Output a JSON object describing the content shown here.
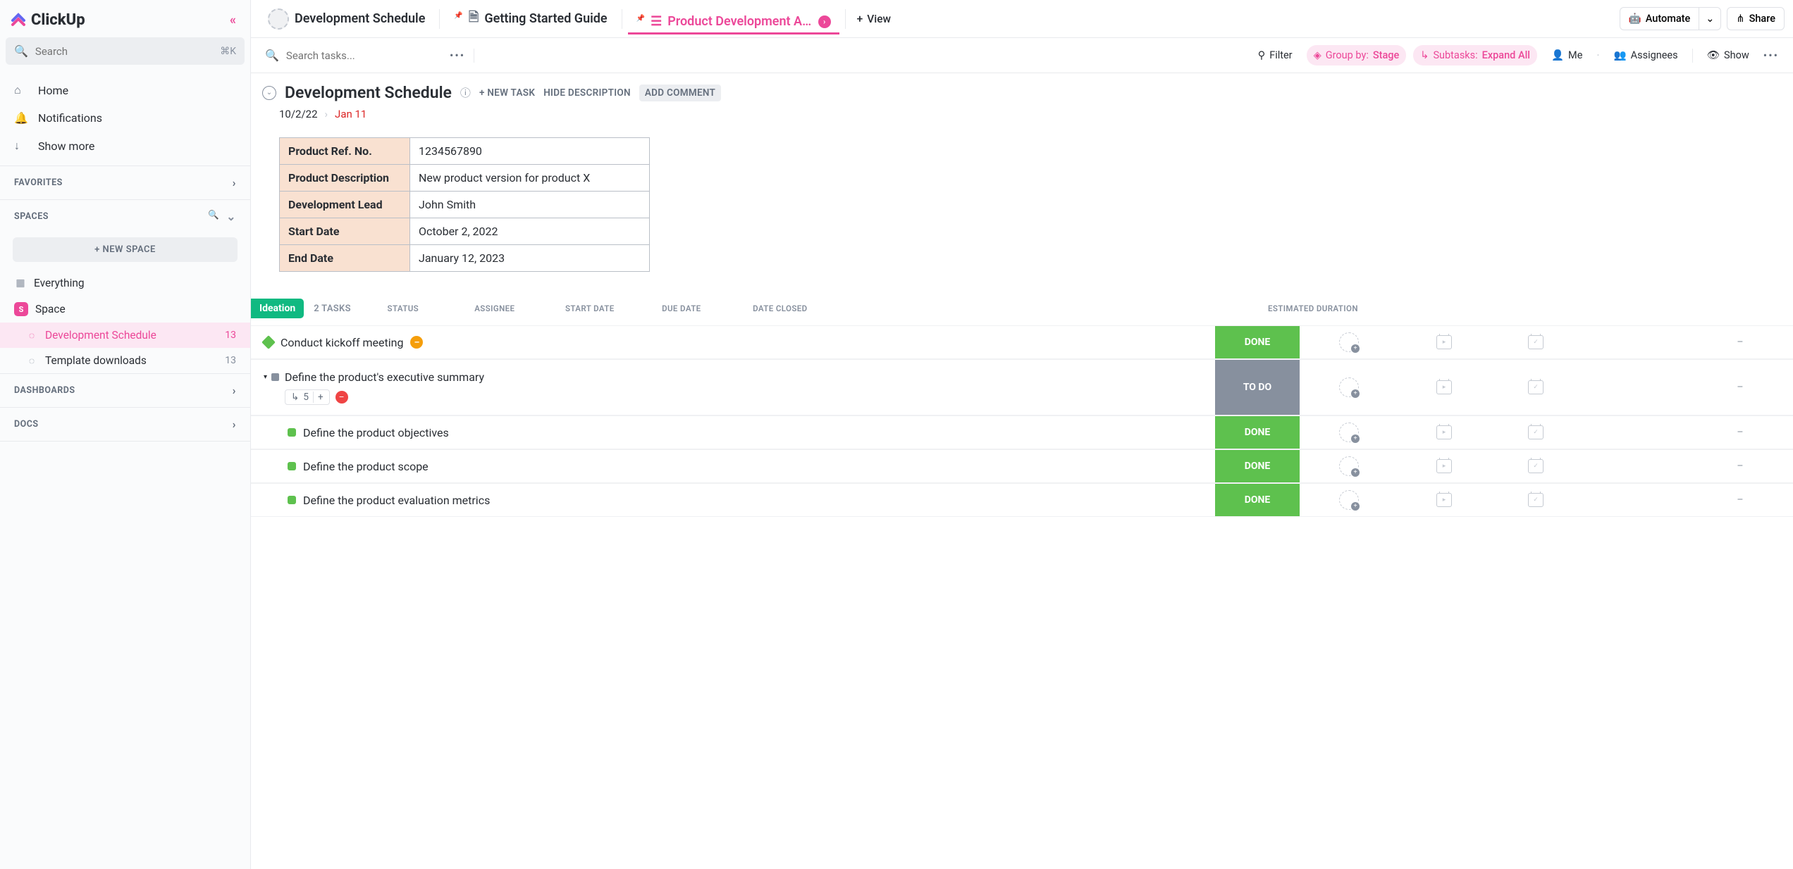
{
  "sidebar": {
    "brand": "ClickUp",
    "search_placeholder": "Search",
    "search_shortcut": "⌘K",
    "nav": [
      {
        "label": "Home"
      },
      {
        "label": "Notifications"
      },
      {
        "label": "Show more"
      }
    ],
    "favorites_title": "FAVORITES",
    "spaces_title": "SPACES",
    "new_space": "NEW SPACE",
    "everything": "Everything",
    "space_letter": "S",
    "space_name": "Space",
    "lists": [
      {
        "label": "Development Schedule",
        "count": "13",
        "active": true
      },
      {
        "label": "Template downloads",
        "count": "13",
        "active": false
      }
    ],
    "dashboards": "DASHBOARDS",
    "docs": "DOCS"
  },
  "tabs": {
    "items": [
      {
        "label": "Development Schedule"
      },
      {
        "label": "Getting Started Guide"
      },
      {
        "label": "Product Development Activities"
      }
    ],
    "add_view": "View",
    "automate": "Automate",
    "share": "Share"
  },
  "toolbar": {
    "search_placeholder": "Search tasks...",
    "filter": "Filter",
    "group_by_label": "Group by:",
    "group_by_value": "Stage",
    "subtasks_label": "Subtasks:",
    "subtasks_value": "Expand All",
    "me": "Me",
    "assignees": "Assignees",
    "show": "Show"
  },
  "page": {
    "title": "Development Schedule",
    "new_task": "+ NEW TASK",
    "hide_desc": "HIDE DESCRIPTION",
    "add_comment": "ADD COMMENT",
    "created": "10/2/22",
    "due": "Jan 11",
    "info": [
      {
        "k": "Product Ref. No.",
        "v": "1234567890"
      },
      {
        "k": "Product Description",
        "v": "New product version for product X"
      },
      {
        "k": "Development Lead",
        "v": "John Smith"
      },
      {
        "k": "Start Date",
        "v": "October 2, 2022"
      },
      {
        "k": "End Date",
        "v": "January 12, 2023"
      }
    ]
  },
  "group": {
    "name": "Ideation",
    "count": "2 TASKS",
    "cols": {
      "status": "STATUS",
      "assignee": "ASSIGNEE",
      "start": "START DATE",
      "due": "DUE DATE",
      "closed": "DATE CLOSED",
      "est": "ESTIMATED DURATION"
    }
  },
  "tasks": [
    {
      "name": "Conduct kickoff meeting",
      "status": "DONE",
      "status_class": "done",
      "kind": "top",
      "priority": "urgent"
    },
    {
      "name": "Define the product's executive summary",
      "status": "TO DO",
      "status_class": "todo",
      "kind": "top-todo",
      "sub_count": "5",
      "priority": "high"
    },
    {
      "name": "Define the product objectives",
      "status": "DONE",
      "status_class": "done",
      "kind": "sub"
    },
    {
      "name": "Define the product scope",
      "status": "DONE",
      "status_class": "done",
      "kind": "sub"
    },
    {
      "name": "Define the product evaluation metrics",
      "status": "DONE",
      "status_class": "done",
      "kind": "sub"
    }
  ],
  "dash": "–"
}
